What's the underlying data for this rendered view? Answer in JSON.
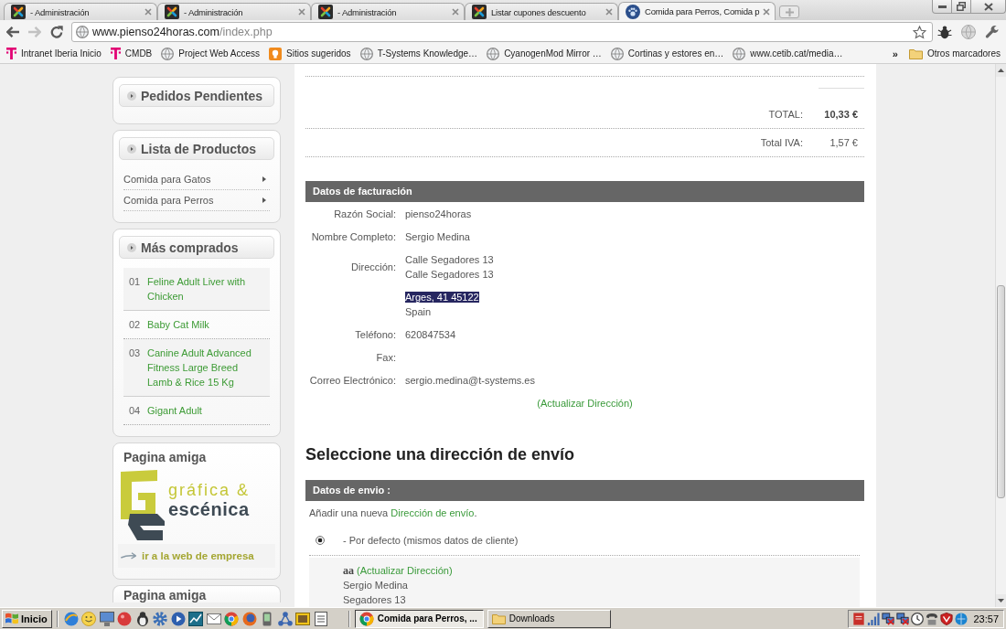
{
  "browser": {
    "tabs": [
      {
        "title": "- Administración",
        "kind": "admin",
        "selected": false
      },
      {
        "title": "- Administración",
        "kind": "admin",
        "selected": false
      },
      {
        "title": "- Administración",
        "kind": "admin",
        "selected": false
      },
      {
        "title": "Listar cupones descuento",
        "kind": "admin",
        "selected": false
      },
      {
        "title": "Comida para Perros, Comida p",
        "kind": "shop",
        "selected": true
      }
    ],
    "navigation": [
      {
        "kind": "back",
        "disabled": false
      },
      {
        "kind": "forward",
        "disabled": true
      },
      {
        "kind": "reload",
        "disabled": false
      }
    ],
    "address": {
      "host": "www.pienso24horas.com",
      "path": "/index.php"
    },
    "bookmarks": [
      {
        "label": "Intranet Iberia Inicio",
        "kind": "brand"
      },
      {
        "label": "CMDB",
        "kind": "brand"
      },
      {
        "label": "Project Web Access",
        "kind": "page"
      },
      {
        "label": "Sitios sugeridos",
        "kind": "suggested"
      },
      {
        "label": "T-Systems Knowledge…",
        "kind": "page"
      },
      {
        "label": "CyanogenMod Mirror …",
        "kind": "page"
      },
      {
        "label": "Cortinas y estores en…",
        "kind": "page"
      },
      {
        "label": "www.cetib.cat/media…",
        "kind": "page"
      }
    ],
    "bookmarks_overflow": "»",
    "other_bookmarks": "Otros marcadores"
  },
  "sidebar": {
    "panels": [
      {
        "kind": "header",
        "title": "Pedidos Pendientes"
      },
      {
        "kind": "menu",
        "title": "Lista de Productos",
        "items": [
          {
            "label": "Comida para Gatos"
          },
          {
            "label": "Comida para Perros"
          }
        ]
      },
      {
        "kind": "ranking",
        "title": "Más comprados",
        "items": [
          {
            "rank": "01",
            "name": "Feline Adult Liver with Chicken"
          },
          {
            "rank": "02",
            "name": "Baby Cat Milk"
          },
          {
            "rank": "03",
            "name": "Canine Adult Advanced Fitness Large Breed Lamb & Rice 15 Kg"
          },
          {
            "rank": "04",
            "name": "Gigant Adult"
          }
        ]
      },
      {
        "kind": "partner",
        "title": "Pagina amiga",
        "logo_text": [
          "gráfica &",
          "escénica"
        ],
        "link": "ir a la web de empresa"
      },
      {
        "kind": "partner",
        "title": "Pagina amiga"
      }
    ]
  },
  "order": {
    "totals": [
      {
        "label": "TOTAL:",
        "value": "10,33 €",
        "bold": true
      },
      {
        "label": "Total IVA:",
        "value": "1,57 €",
        "bold": false
      }
    ],
    "billing": {
      "title": "Datos de facturación",
      "rows": [
        {
          "label": "Razón Social:",
          "lines": [
            {
              "text": "pienso24horas",
              "highlighted": false
            }
          ]
        },
        {
          "label": "Nombre Completo:",
          "lines": [
            {
              "text": "Sergio Medina",
              "highlighted": false
            }
          ]
        },
        {
          "label": "Dirección:",
          "lines": [
            {
              "text": "Calle Segadores 13",
              "highlighted": false
            },
            {
              "text": "Calle Segadores 13",
              "highlighted": false
            }
          ]
        },
        {
          "lines": [
            {
              "text": "Arges, 41 45122",
              "highlighted": true
            },
            {
              "text": "Spain",
              "highlighted": false
            }
          ]
        },
        {
          "label": "Teléfono:",
          "lines": [
            {
              "text": "620847534",
              "highlighted": false
            }
          ]
        },
        {
          "label": "Fax:"
        },
        {
          "label": "Correo Electrónico:",
          "lines": [
            {
              "text": "sergio.medina@t-systems.es",
              "highlighted": false
            }
          ]
        }
      ],
      "update_link": "(Actualizar Dirección)"
    },
    "shipping": {
      "heading": "Seleccione una dirección de envío",
      "title": "Datos de envio :",
      "add_prefix": "Añadir una nueva",
      "add_link": "Dirección de envío",
      "add_suffix": ".",
      "options": [
        {
          "label": "- Por defecto (mismos datos de cliente)",
          "selected": true
        }
      ],
      "address": {
        "name": "aa",
        "update_link": "(Actualizar Dirección)",
        "lines": [
          "Sergio Medina",
          "Segadores 13"
        ]
      }
    }
  },
  "taskbar": {
    "start": "Inicio",
    "tasks": [
      {
        "label": "Comida para Perros, ...",
        "kind": "browser",
        "selected": true
      },
      {
        "label": "Downloads",
        "kind": "folder",
        "selected": false
      }
    ],
    "clock": "23:57"
  }
}
